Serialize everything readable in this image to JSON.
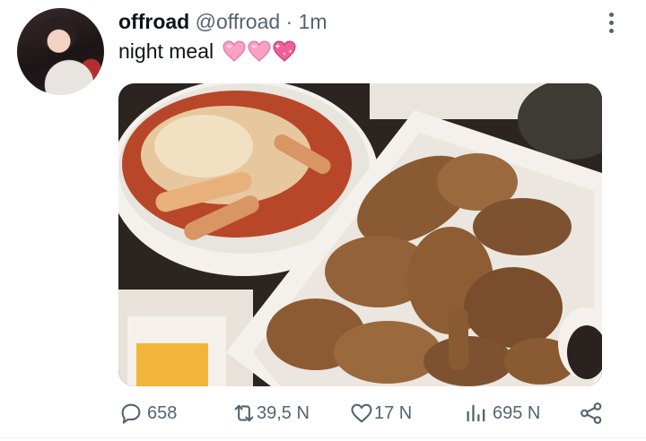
{
  "tweet": {
    "display_name": "offroad",
    "handle": "@offroad",
    "separator": "·",
    "time": "1m",
    "text": "night meal",
    "emojis": [
      "pink-heart",
      "pink-heart",
      "sparkling-heart"
    ]
  },
  "media": {
    "description_icon": "photo-food"
  },
  "actions": {
    "replies": "658",
    "retweets": "39,5 N",
    "likes": "17 N",
    "views": "695 N"
  },
  "colors": {
    "secondary_text": "#536471",
    "heart_pink": "#f7a1c4"
  }
}
